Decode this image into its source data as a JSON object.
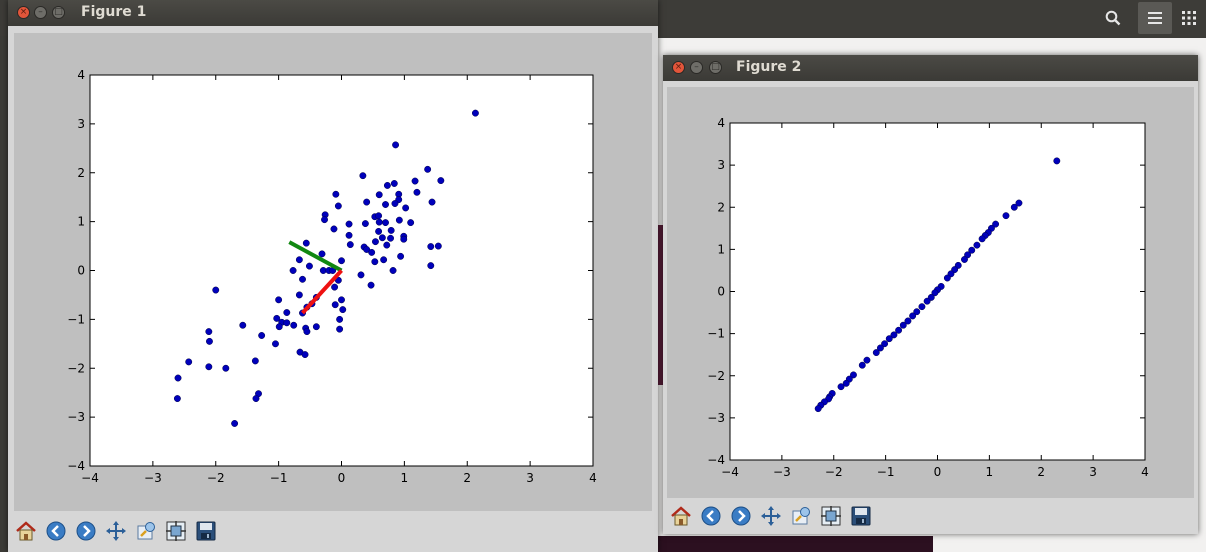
{
  "figure1": {
    "title": "Figure 1",
    "chart_data": {
      "type": "scatter",
      "title": "",
      "xlabel": "",
      "ylabel": "",
      "xlim": [
        -4,
        4
      ],
      "ylim": [
        -4,
        4
      ],
      "xticks": [
        -4,
        -3,
        -2,
        -1,
        0,
        1,
        2,
        3,
        4
      ],
      "yticks": [
        -4,
        -3,
        -2,
        -1,
        0,
        1,
        2,
        3,
        4
      ],
      "xtick_labels": [
        "−4",
        "−3",
        "−2",
        "−1",
        "0",
        "1",
        "2",
        "3",
        "4"
      ],
      "ytick_labels": [
        "−4",
        "−3",
        "−2",
        "−1",
        "0",
        "1",
        "2",
        "3",
        "4"
      ],
      "points": [
        [
          2.13,
          3.22
        ],
        [
          0.86,
          2.57
        ],
        [
          1.37,
          2.07
        ],
        [
          0.34,
          1.94
        ],
        [
          1.58,
          1.84
        ],
        [
          1.17,
          1.83
        ],
        [
          0.84,
          1.78
        ],
        [
          0.73,
          1.74
        ],
        [
          1.2,
          1.6
        ],
        [
          0.91,
          1.56
        ],
        [
          0.6,
          1.55
        ],
        [
          0.91,
          1.45
        ],
        [
          -0.09,
          1.56
        ],
        [
          0.4,
          1.4
        ],
        [
          1.44,
          1.4
        ],
        [
          0.85,
          1.37
        ],
        [
          0.7,
          1.35
        ],
        [
          -0.05,
          1.32
        ],
        [
          1.02,
          1.28
        ],
        [
          0.53,
          1.1
        ],
        [
          -0.26,
          1.14
        ],
        [
          0.59,
          1.12
        ],
        [
          0.92,
          1.03
        ],
        [
          -0.27,
          1.04
        ],
        [
          0.7,
          0.98
        ],
        [
          0.6,
          0.99
        ],
        [
          1.1,
          0.98
        ],
        [
          0.38,
          0.96
        ],
        [
          0.12,
          0.95
        ],
        [
          -0.12,
          0.85
        ],
        [
          0.79,
          0.82
        ],
        [
          0.59,
          0.8
        ],
        [
          0.12,
          0.72
        ],
        [
          0.99,
          0.7
        ],
        [
          0.65,
          0.67
        ],
        [
          0.78,
          0.66
        ],
        [
          0.99,
          0.64
        ],
        [
          0.54,
          0.59
        ],
        [
          -0.56,
          0.56
        ],
        [
          0.14,
          0.53
        ],
        [
          0.72,
          0.52
        ],
        [
          1.42,
          0.49
        ],
        [
          1.54,
          0.5
        ],
        [
          0.36,
          0.48
        ],
        [
          0.4,
          0.43
        ],
        [
          0.48,
          0.37
        ],
        [
          -0.31,
          0.34
        ],
        [
          0.94,
          0.29
        ],
        [
          -0.67,
          0.22
        ],
        [
          0.67,
          0.22
        ],
        [
          0.0,
          0.2
        ],
        [
          0.53,
          0.18
        ],
        [
          -0.51,
          0.09
        ],
        [
          -0.29,
          0.0
        ],
        [
          -0.2,
          0.0
        ],
        [
          -0.14,
          0.0
        ],
        [
          -0.77,
          0.0
        ],
        [
          0.82,
          0.0
        ],
        [
          1.42,
          0.1
        ],
        [
          0.31,
          -0.09
        ],
        [
          -0.62,
          -0.18
        ],
        [
          -0.05,
          -0.2
        ],
        [
          0.47,
          -0.3
        ],
        [
          -0.11,
          -0.34
        ],
        [
          -2.0,
          -0.4
        ],
        [
          -0.67,
          -0.5
        ],
        [
          -0.4,
          -0.55
        ],
        [
          -1.0,
          -0.6
        ],
        [
          0.0,
          -0.6
        ],
        [
          -0.47,
          -0.68
        ],
        [
          -0.1,
          -0.7
        ],
        [
          -0.55,
          -0.75
        ],
        [
          0.02,
          -0.8
        ],
        [
          -0.87,
          -0.86
        ],
        [
          -0.62,
          -0.87
        ],
        [
          -1.03,
          -0.98
        ],
        [
          -0.95,
          -1.06
        ],
        [
          -0.03,
          -1.0
        ],
        [
          -0.87,
          -1.07
        ],
        [
          -0.76,
          -1.12
        ],
        [
          -1.57,
          -1.12
        ],
        [
          -0.57,
          -1.18
        ],
        [
          -0.55,
          -1.25
        ],
        [
          -2.11,
          -1.25
        ],
        [
          -0.99,
          -1.15
        ],
        [
          -0.4,
          -1.15
        ],
        [
          -0.03,
          -1.2
        ],
        [
          -1.27,
          -1.33
        ],
        [
          -2.1,
          -1.45
        ],
        [
          -1.05,
          -1.5
        ],
        [
          -0.66,
          -1.67
        ],
        [
          -0.58,
          -1.72
        ],
        [
          -1.37,
          -1.85
        ],
        [
          -2.43,
          -1.87
        ],
        [
          -2.11,
          -1.97
        ],
        [
          -1.84,
          -2.0
        ],
        [
          -2.6,
          -2.2
        ],
        [
          -1.32,
          -2.52
        ],
        [
          -2.61,
          -2.62
        ],
        [
          -1.36,
          -2.62
        ],
        [
          -1.7,
          -3.13
        ]
      ],
      "lines": [
        {
          "color": "#118811",
          "x": [
            0.0,
            -0.83
          ],
          "y": [
            0.0,
            0.58
          ]
        },
        {
          "color": "#ee1111",
          "x": [
            0.0,
            -0.62
          ],
          "y": [
            0.0,
            -0.87
          ]
        }
      ],
      "marker_color": "#0000bb"
    }
  },
  "figure2": {
    "title": "Figure 2",
    "chart_data": {
      "type": "scatter",
      "title": "",
      "xlabel": "",
      "ylabel": "",
      "xlim": [
        -4,
        4
      ],
      "ylim": [
        -4,
        4
      ],
      "xticks": [
        -4,
        -3,
        -2,
        -1,
        0,
        1,
        2,
        3,
        4
      ],
      "yticks": [
        -4,
        -3,
        -2,
        -1,
        0,
        1,
        2,
        3,
        4
      ],
      "xtick_labels": [
        "−4",
        "−3",
        "−2",
        "−1",
        "0",
        "1",
        "2",
        "3",
        "4"
      ],
      "ytick_labels": [
        "−4",
        "−3",
        "−2",
        "−1",
        "0",
        "1",
        "2",
        "3",
        "4"
      ],
      "points": [
        [
          2.3,
          3.1
        ],
        [
          1.57,
          2.1
        ],
        [
          1.48,
          2.0
        ],
        [
          1.32,
          1.8
        ],
        [
          1.12,
          1.6
        ],
        [
          1.04,
          1.5
        ],
        [
          0.98,
          1.4
        ],
        [
          0.92,
          1.33
        ],
        [
          0.86,
          1.25
        ],
        [
          0.76,
          1.1
        ],
        [
          0.66,
          0.98
        ],
        [
          0.58,
          0.87
        ],
        [
          0.52,
          0.76
        ],
        [
          0.4,
          0.62
        ],
        [
          0.33,
          0.52
        ],
        [
          0.26,
          0.42
        ],
        [
          0.19,
          0.32
        ],
        [
          0.07,
          0.12
        ],
        [
          0.0,
          0.04
        ],
        [
          -0.05,
          -0.03
        ],
        [
          -0.12,
          -0.14
        ],
        [
          -0.2,
          -0.23
        ],
        [
          -0.3,
          -0.36
        ],
        [
          -0.4,
          -0.48
        ],
        [
          -0.48,
          -0.58
        ],
        [
          -0.57,
          -0.7
        ],
        [
          -0.66,
          -0.8
        ],
        [
          -0.75,
          -0.92
        ],
        [
          -0.84,
          -1.03
        ],
        [
          -0.93,
          -1.12
        ],
        [
          -1.02,
          -1.24
        ],
        [
          -1.1,
          -1.34
        ],
        [
          -1.18,
          -1.45
        ],
        [
          -1.36,
          -1.63
        ],
        [
          -1.45,
          -1.75
        ],
        [
          -1.62,
          -1.98
        ],
        [
          -1.7,
          -2.08
        ],
        [
          -1.76,
          -2.18
        ],
        [
          -1.86,
          -2.26
        ],
        [
          -2.03,
          -2.42
        ],
        [
          -2.08,
          -2.5
        ],
        [
          -2.1,
          -2.55
        ],
        [
          -2.18,
          -2.62
        ],
        [
          -2.25,
          -2.7
        ],
        [
          -2.3,
          -2.78
        ]
      ],
      "marker_color": "#0000bb"
    }
  },
  "toolbar": {
    "buttons": [
      {
        "name": "home-icon",
        "label": "Home"
      },
      {
        "name": "back-icon",
        "label": "Back"
      },
      {
        "name": "forward-icon",
        "label": "Forward"
      },
      {
        "name": "pan-icon",
        "label": "Pan"
      },
      {
        "name": "zoom-icon",
        "label": "Zoom"
      },
      {
        "name": "subplots-icon",
        "label": "Configure subplots"
      },
      {
        "name": "save-icon",
        "label": "Save"
      }
    ]
  },
  "desktop": {
    "search_icon": "search-icon",
    "menu_icon": "menu-icon",
    "apps_icon": "apps-icon"
  }
}
